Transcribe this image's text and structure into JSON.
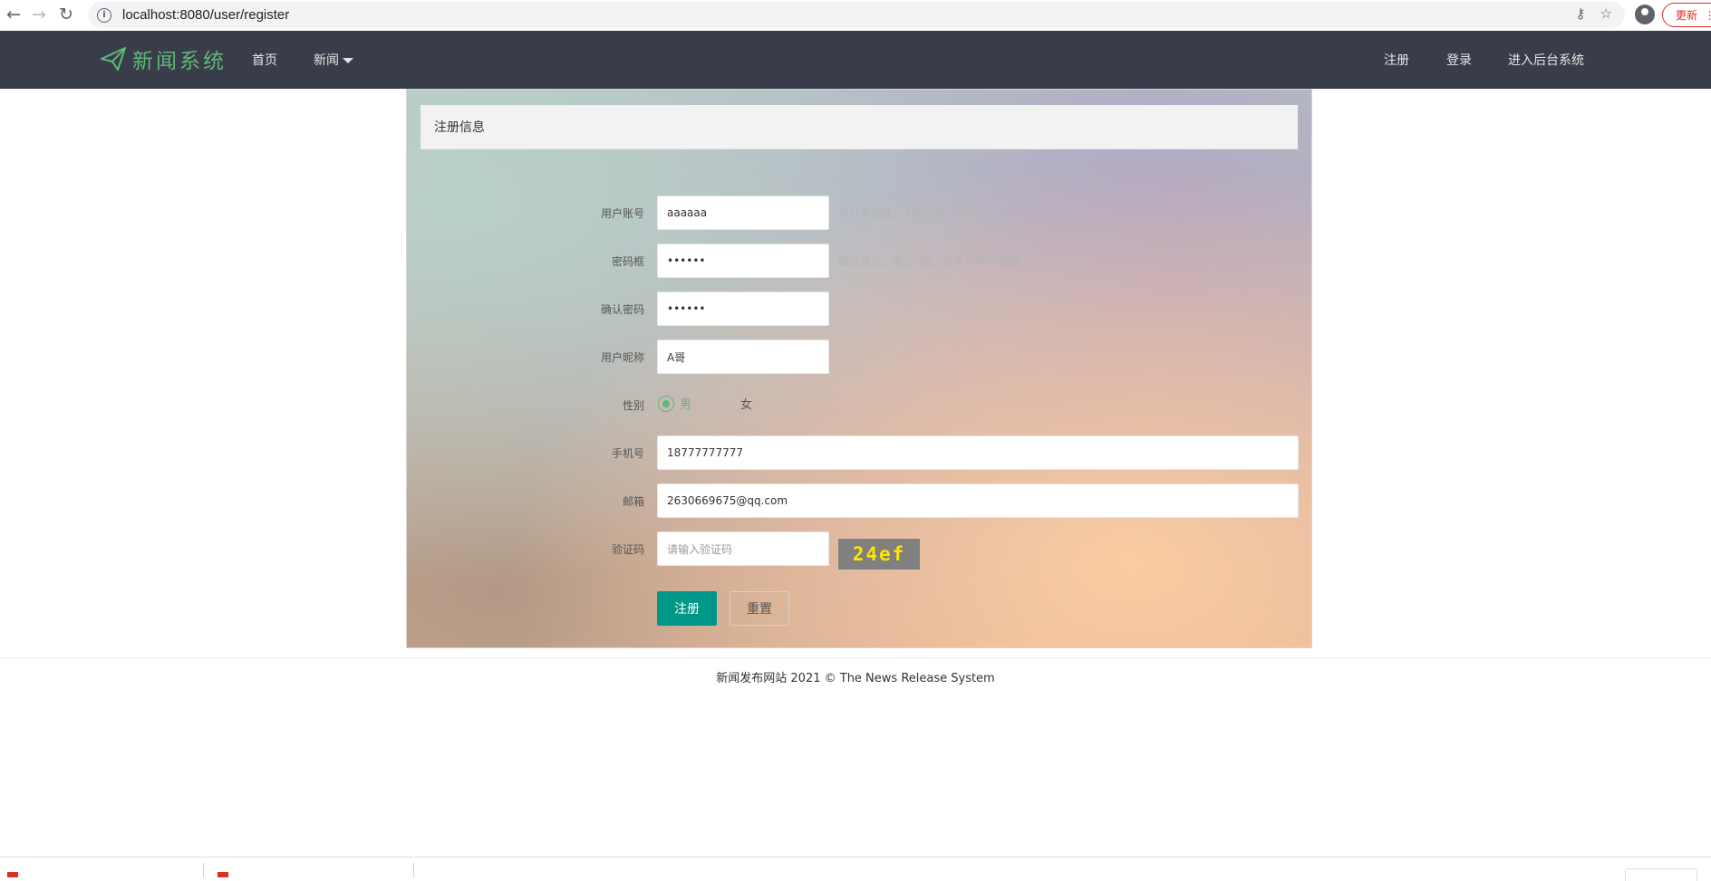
{
  "browser": {
    "url": "localhost:8080/user/register",
    "update_label": "更新"
  },
  "nav": {
    "logo": "新闻系统",
    "home": "首页",
    "news": "新闻",
    "register": "注册",
    "login": "登录",
    "admin": "进入后台系统"
  },
  "form": {
    "header": "注册信息",
    "username": {
      "label": "用户账号",
      "value": "aaaaaa",
      "hint": "用户名格式：4到10位，由大小写字母和数字组成"
    },
    "password": {
      "label": "密码框",
      "value": "••••••",
      "hint": "密码格式：至少6位，英文与数字组成"
    },
    "confirm": {
      "label": "确认密码",
      "value": "••••••"
    },
    "nickname": {
      "label": "用户昵称",
      "value": "A哥"
    },
    "gender": {
      "label": "性别",
      "male": "男",
      "female": "女",
      "selected": "男"
    },
    "phone": {
      "label": "手机号",
      "value": "18777777777"
    },
    "email": {
      "label": "邮箱",
      "value": "2630669675@qq.com"
    },
    "captcha": {
      "label": "验证码",
      "placeholder": "请输入验证码",
      "image_text": "24ef"
    },
    "submit": "注册",
    "reset": "重置"
  },
  "footer": "新闻发布网站 2021 © The News Release System",
  "colors": {
    "nav_bg": "#393d49",
    "accent_green": "#5fb878",
    "primary_button": "#009688"
  }
}
